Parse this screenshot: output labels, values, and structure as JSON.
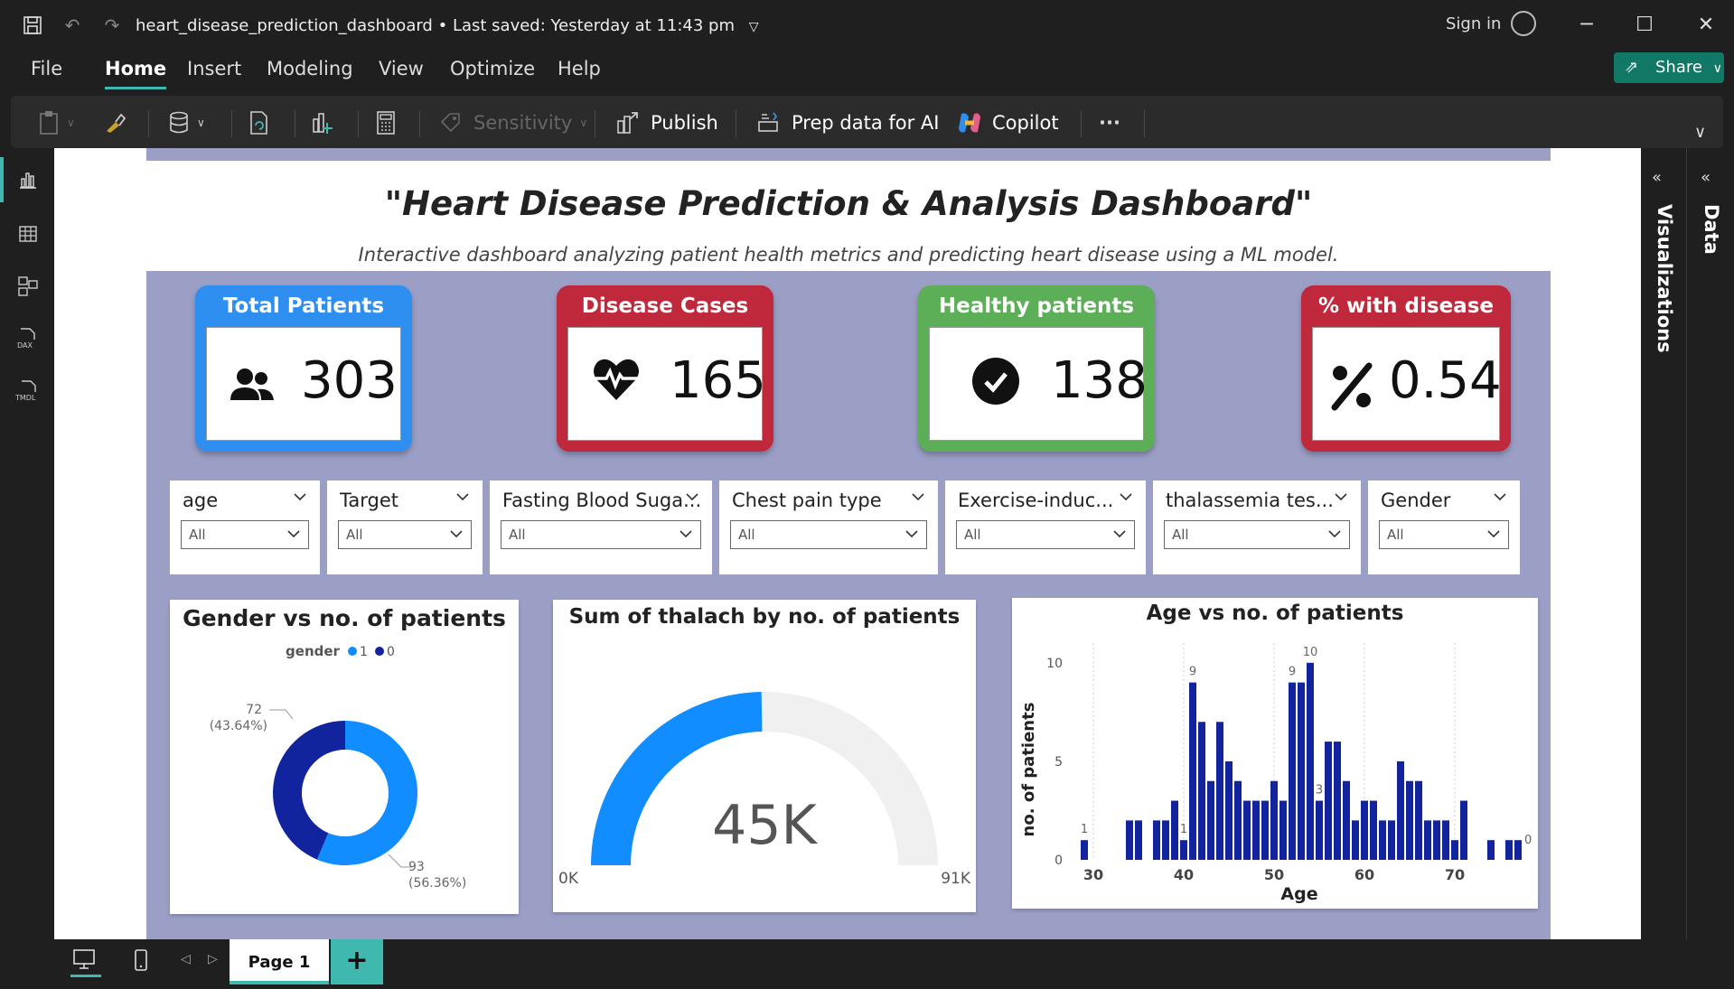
{
  "window": {
    "doc_title": "heart_disease_prediction_dashboard",
    "saved_status": "Last saved: Yesterday at 11:43 pm",
    "sign_in": "Sign in"
  },
  "menu": {
    "items": [
      "File",
      "Home",
      "Insert",
      "Modeling",
      "View",
      "Optimize",
      "Help"
    ],
    "active": "Home",
    "share_label": "Share"
  },
  "ribbon": {
    "sensitivity": "Sensitivity",
    "publish": "Publish",
    "prep_data": "Prep data for AI",
    "copilot": "Copilot",
    "more": "···"
  },
  "report": {
    "title": "\"Heart Disease Prediction & Analysis Dashboard\"",
    "subtitle": "Interactive dashboard analyzing patient health metrics and predicting heart disease using a ML model."
  },
  "kpis": [
    {
      "title": "Total Patients",
      "value": "303",
      "icon": "people-icon",
      "color": "#2f8ff0"
    },
    {
      "title": "Disease Cases",
      "value": "165",
      "icon": "heartbeat-icon",
      "color": "#c0283c"
    },
    {
      "title": "Healthy patients",
      "value": "138",
      "icon": "check-circle-icon",
      "color": "#5caf56"
    },
    {
      "title": "% with disease",
      "value": "0.54",
      "icon": "percent-icon",
      "color": "#c0283c"
    }
  ],
  "slicers": [
    {
      "label": "age",
      "value": "All"
    },
    {
      "label": "Target",
      "value": "All"
    },
    {
      "label": "Fasting Blood Suga...",
      "value": "All"
    },
    {
      "label": "Chest pain type",
      "value": "All"
    },
    {
      "label": "Exercise-induc...",
      "value": "All"
    },
    {
      "label": "thalassemia tes...",
      "value": "All"
    },
    {
      "label": "Gender",
      "value": "All"
    }
  ],
  "donut": {
    "title": "Gender vs no. of patients",
    "legend_title": "gender",
    "legend": [
      "1",
      "0"
    ],
    "label_1_count": "93",
    "label_1_pct": "(56.36%)",
    "label_0_count": "72",
    "label_0_pct": "(43.64%)"
  },
  "gauge": {
    "title": "Sum of thalach by no. of patients",
    "value_label": "45K",
    "min_label": "0K",
    "max_label": "91K"
  },
  "histogram": {
    "title": "Age vs no. of patients",
    "xlabel": "Age",
    "ylabel": "no. of patients",
    "x_ticks": [
      "30",
      "40",
      "50",
      "60",
      "70"
    ],
    "y_ticks": [
      "0",
      "5",
      "10"
    ],
    "labels": {
      "a": "1",
      "b": "9",
      "c": "1",
      "d": "9",
      "e": "10",
      "f": "3",
      "g": "0"
    }
  },
  "chart_data": [
    {
      "type": "pie",
      "title": "Gender vs no. of patients",
      "categories": [
        "1",
        "0"
      ],
      "values": [
        93,
        72
      ],
      "percent": [
        56.36,
        43.64
      ],
      "colors": [
        "#118dff",
        "#12239e"
      ]
    },
    {
      "type": "gauge",
      "title": "Sum of thalach by no. of patients",
      "value": 45,
      "min": 0,
      "max": 91,
      "unit": "K",
      "colors": [
        "#118dff",
        "#f0f0f0"
      ]
    },
    {
      "type": "bar",
      "title": "Age vs no. of patients",
      "xlabel": "Age",
      "ylabel": "no. of patients",
      "x": [
        29,
        34,
        35,
        37,
        38,
        39,
        40,
        41,
        42,
        43,
        44,
        45,
        46,
        47,
        48,
        49,
        50,
        51,
        52,
        53,
        54,
        55,
        56,
        57,
        58,
        59,
        60,
        61,
        62,
        63,
        64,
        65,
        66,
        67,
        68,
        69,
        70,
        71,
        74,
        76,
        77
      ],
      "values": [
        1,
        2,
        2,
        2,
        2,
        3,
        1,
        9,
        7,
        4,
        7,
        5,
        4,
        3,
        3,
        3,
        4,
        3,
        9,
        9,
        10,
        3,
        6,
        6,
        4,
        2,
        3,
        3,
        2,
        2,
        5,
        4,
        4,
        2,
        2,
        2,
        1,
        3,
        1,
        1,
        1
      ],
      "xlim": [
        28,
        78
      ],
      "ylim": [
        0,
        11
      ],
      "color": "#12239e"
    }
  ],
  "pages": {
    "tab": "Page 1",
    "add": "+"
  },
  "panes": {
    "visualizations": "Visualizations",
    "data": "Data"
  }
}
